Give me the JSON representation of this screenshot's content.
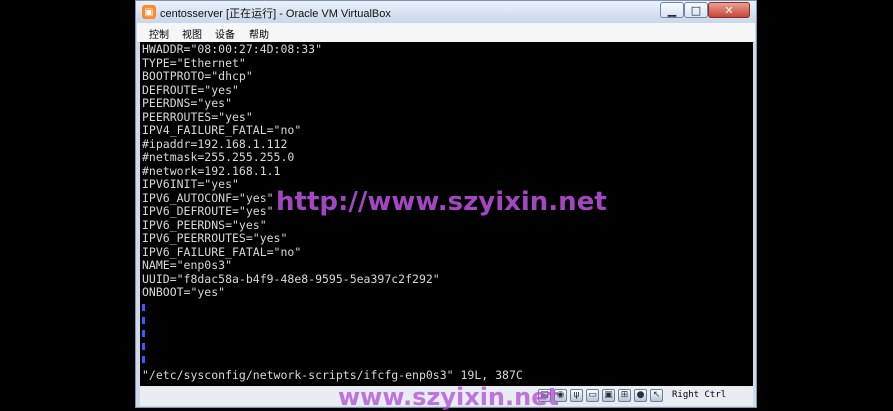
{
  "window": {
    "title": "centosserver [正在运行] - Oracle VM VirtualBox",
    "app_icon": "virtualbox-icon",
    "controls": {
      "minimize": "▁",
      "maximize": "□",
      "close": "✕"
    }
  },
  "menubar": {
    "items": [
      "控制",
      "视图",
      "设备",
      "帮助"
    ]
  },
  "console": {
    "lines": [
      "HWADDR=\"08:00:27:4D:08:33\"",
      "TYPE=\"Ethernet\"",
      "BOOTPROTO=\"dhcp\"",
      "DEFROUTE=\"yes\"",
      "PEERDNS=\"yes\"",
      "PEERROUTES=\"yes\"",
      "IPV4_FAILURE_FATAL=\"no\"",
      "#ipaddr=192.168.1.112",
      "#netmask=255.255.255.0",
      "#network=192.168.1.1",
      "IPV6INIT=\"yes\"",
      "IPV6_AUTOCONF=\"yes\"",
      "IPV6_DEFROUTE=\"yes\"",
      "IPV6_PEERDNS=\"yes\"",
      "IPV6_PEERROUTES=\"yes\"",
      "IPV6_FAILURE_FATAL=\"no\"",
      "NAME=\"enp0s3\"",
      "UUID=\"f8dac58a-b4f9-48e8-9595-5ea397c2f292\"",
      "ONBOOT=\"yes\""
    ],
    "file_status": "\"/etc/sysconfig/network-scripts/ifcfg-enp0s3\" 19L, 387C"
  },
  "statusbar": {
    "icons": [
      "hdd-icon",
      "cd-icon",
      "usb-icon",
      "shared-folder-icon",
      "display-icon",
      "network-icon",
      "video-capture-icon",
      "mouse-integration-icon",
      "host-key-icon"
    ],
    "host_key": "Right Ctrl"
  },
  "watermark": {
    "text": "http://www.szyixin.net",
    "text_bottom": "www.szyixin.net"
  }
}
